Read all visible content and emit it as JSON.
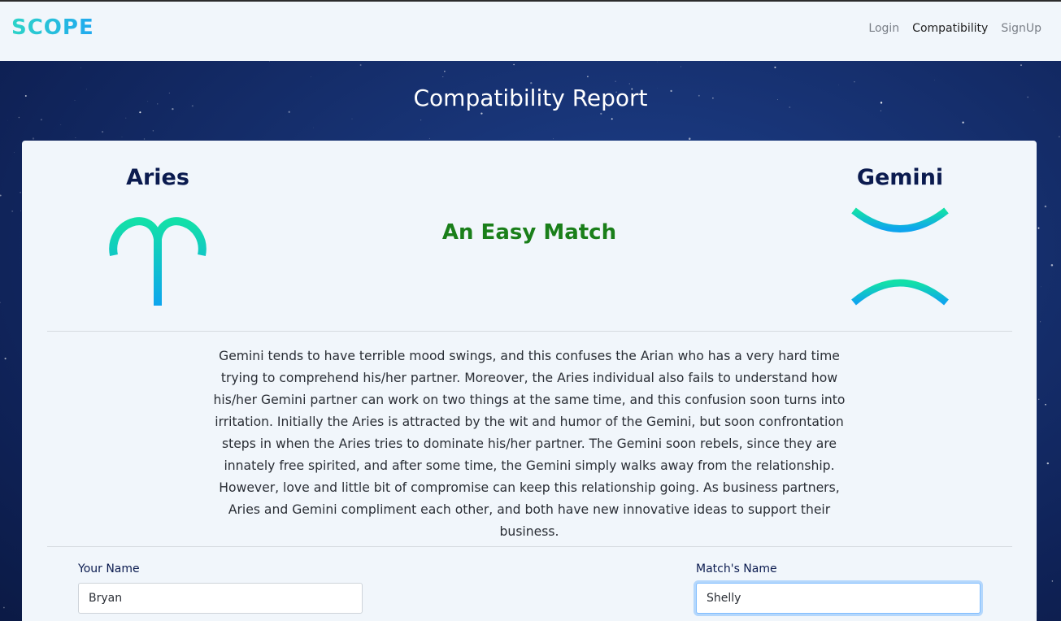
{
  "brand": "SCOPE",
  "nav": {
    "login": "Login",
    "compatibility": "Compatibility",
    "signup": "SignUp"
  },
  "page_title": "Compatibility Report",
  "report": {
    "sign_left": "Aries",
    "sign_right": "Gemini",
    "match": "An Easy Match",
    "description": "Gemini tends to have terrible mood swings, and this confuses the Arian who has a very hard time trying to comprehend his/her partner. Moreover, the Aries individual also fails to understand how his/her Gemini partner can work on two things at the same time, and this confusion soon turns into irritation. Initially the Aries is attracted by the wit and humor of the Gemini, but soon confrontation steps in when the Aries tries to dominate his/her partner. The Gemini soon rebels, since they are innately free spirited, and after some time, the Gemini simply walks away from the relationship. However, love and little bit of compromise can keep this relationship going. As business partners, Aries and Gemini compliment each other, and both have new innovative ideas to support their business."
  },
  "form": {
    "your_name_label": "Your Name",
    "your_name_value": "Bryan",
    "match_name_label": "Match's Name",
    "match_name_value": "Shelly"
  },
  "icons": {
    "left": "aries-icon",
    "right": "gemini-icon"
  },
  "colors": {
    "brand_gradient_start": "#2dd4c8",
    "brand_gradient_end": "#20a8f0",
    "match_green": "#1a7f1a",
    "sign_name_navy": "#0b1b4f",
    "icon_gradient_top": "#12e0a8",
    "icon_gradient_bottom": "#0ea5ee"
  }
}
